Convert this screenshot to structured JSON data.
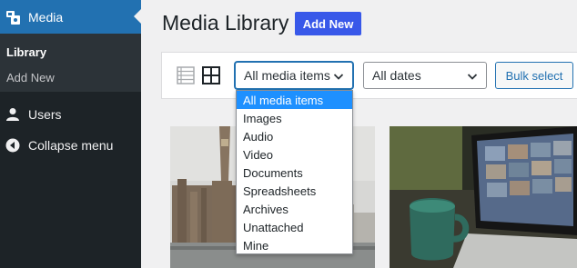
{
  "sidebar": {
    "media_label": "Media",
    "sub_items": [
      "Library",
      "Add New"
    ],
    "users_label": "Users",
    "collapse_label": "Collapse menu"
  },
  "header": {
    "title": "Media Library",
    "add_new_label": "Add New"
  },
  "toolbar": {
    "type_filter_value": "All media items",
    "date_filter_value": "All dates",
    "bulk_select_label": "Bulk select"
  },
  "dropdown": {
    "options": [
      "All media items",
      "Images",
      "Audio",
      "Video",
      "Documents",
      "Spreadsheets",
      "Archives",
      "Unattached",
      "Mine"
    ],
    "selected_index": 0
  },
  "colors": {
    "sidebar_bg": "#1d2327",
    "active_menu": "#2271b1",
    "add_new_button": "#3858e9",
    "selected_option": "#1e90ff"
  }
}
